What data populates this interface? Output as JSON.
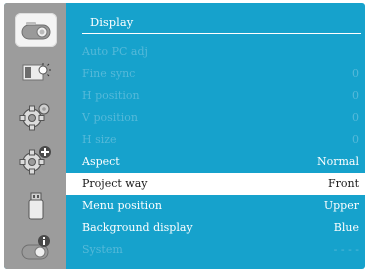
{
  "menu": {
    "title": "Display",
    "items": [
      {
        "label": "Auto PC adj",
        "value": "",
        "state": "disabled"
      },
      {
        "label": "Fine sync",
        "value": "0",
        "state": "disabled"
      },
      {
        "label": "H position",
        "value": "0",
        "state": "disabled"
      },
      {
        "label": "V position",
        "value": "0",
        "state": "disabled"
      },
      {
        "label": "H size",
        "value": "0",
        "state": "disabled"
      },
      {
        "label": "Aspect",
        "value": "Normal",
        "state": "enabled"
      },
      {
        "label": "Project way",
        "value": "Front",
        "state": "selected"
      },
      {
        "label": "Menu position",
        "value": "Upper",
        "state": "enabled"
      },
      {
        "label": "Background display",
        "value": "Blue",
        "state": "enabled"
      },
      {
        "label": "System",
        "value": "- - - -",
        "state": "disabled"
      }
    ]
  },
  "sidebar": {
    "icons": [
      "projector-icon",
      "screen-brightness-icon",
      "gear-icon",
      "gear-plus-icon",
      "usb-icon",
      "info-projector-icon"
    ],
    "active_index": 0
  },
  "colors": {
    "panel": "#16a2cc",
    "sidebar": "#9c9c9c",
    "disabled_text": "#55b9d9",
    "selected_bg": "#ffffff"
  }
}
